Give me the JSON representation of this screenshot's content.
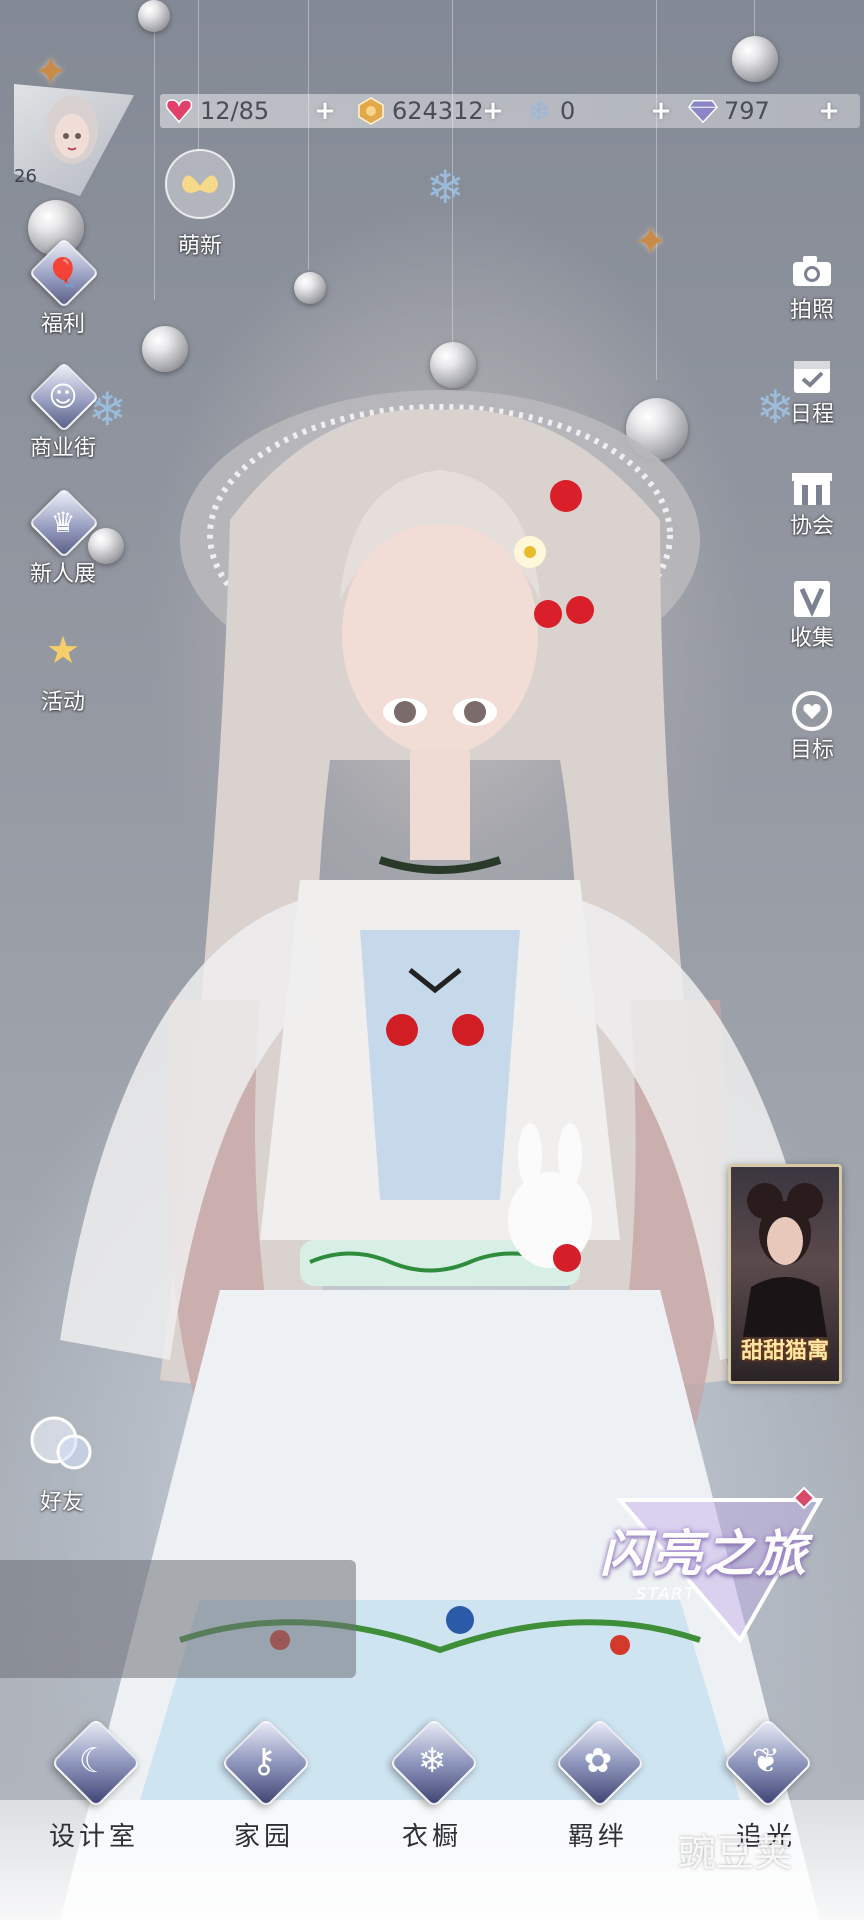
{
  "player": {
    "level": "26"
  },
  "resources": [
    {
      "name": "stamina",
      "icon": "heart-gem-icon",
      "value": "12/85",
      "color": "#e0406a"
    },
    {
      "name": "gold",
      "icon": "gold-coin-icon",
      "value": "624312",
      "color": "#e2a94a"
    },
    {
      "name": "snowflake",
      "icon": "snowflake-crystal-icon",
      "value": "0",
      "color": "#9cb6d8"
    },
    {
      "name": "diamond",
      "icon": "diamond-icon",
      "value": "797",
      "color": "#8a86c8"
    }
  ],
  "newbie": {
    "label": "萌新"
  },
  "left_menu": [
    {
      "label": "福利",
      "icon": "hot-air-balloon-icon"
    },
    {
      "label": "商业街",
      "icon": "shopping-bag-icon"
    },
    {
      "label": "新人展",
      "icon": "crown-stage-icon"
    },
    {
      "label": "活动",
      "icon": "stars-icon"
    }
  ],
  "right_menu": [
    {
      "label": "拍照",
      "icon": "camera-icon"
    },
    {
      "label": "日程",
      "icon": "calendar-check-icon"
    },
    {
      "label": "协会",
      "icon": "building-icon"
    },
    {
      "label": "收集",
      "icon": "v-collection-icon"
    },
    {
      "label": "目标",
      "icon": "target-heart-icon"
    }
  ],
  "friends": {
    "label": "好友"
  },
  "event_card": {
    "caption": "甜甜猫寓"
  },
  "journey": {
    "title": "闪亮之旅",
    "start": "START"
  },
  "bottom_nav": [
    {
      "label": "设计室",
      "icon": "moon-icon"
    },
    {
      "label": "家园",
      "icon": "key-icon"
    },
    {
      "label": "衣橱",
      "icon": "snow-gem-icon"
    },
    {
      "label": "羁绊",
      "icon": "clover-icon"
    },
    {
      "label": "追光",
      "icon": "butterfly-icon"
    }
  ],
  "watermark": {
    "text": "豌豆荚"
  },
  "colors": {
    "accent": "#8a86c8",
    "text_dark": "#4a4d57"
  }
}
